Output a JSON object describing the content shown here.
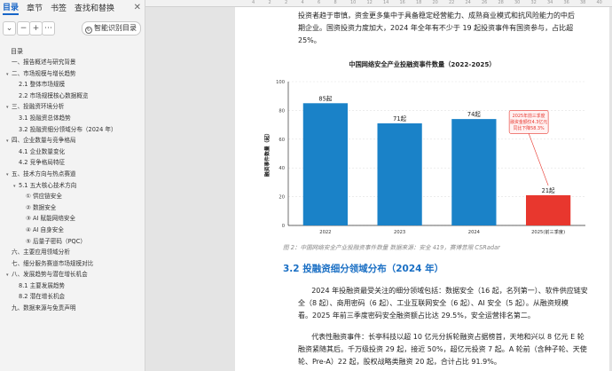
{
  "sidebar": {
    "tabs": [
      "目录",
      "章节",
      "书签",
      "查找和替换"
    ],
    "active_tab": "目录",
    "close_icon": "close-icon",
    "toolbar": {
      "collapse_icon": "chevron-down-icon",
      "add_icon": "plus-icon",
      "remove_icon": "minus-icon",
      "smart_label": "智能识别目录"
    },
    "toc_title": "目录",
    "toc": [
      {
        "text": "一、报告概述与研究背景",
        "level": 1
      },
      {
        "text": "二、市场规模与增长趋势",
        "level": 1,
        "caret": "▾"
      },
      {
        "text": "2.1 整体市场规模",
        "level": 2
      },
      {
        "text": "2.2 市场规模核心数据概览",
        "level": 2
      },
      {
        "text": "三、投融资环境分析",
        "level": 1,
        "caret": "▾"
      },
      {
        "text": "3.1 投融资总体趋势",
        "level": 2
      },
      {
        "text": "3.2 投融资细分领域分布（2024 年）",
        "level": 2
      },
      {
        "text": "四、企业数量与竞争格局",
        "level": 1,
        "caret": "▾"
      },
      {
        "text": "4.1 企业数量变化",
        "level": 2
      },
      {
        "text": "4.2 竞争格局特征",
        "level": 2
      },
      {
        "text": "五、技术方向与热点赛道",
        "level": 1,
        "caret": "▾"
      },
      {
        "text": "5.1 五大核心技术方向",
        "level": 2,
        "caret": "▾"
      },
      {
        "text": "① 供应链安全",
        "level": 3
      },
      {
        "text": "② 数据安全",
        "level": 3
      },
      {
        "text": "③ AI 赋能网络安全",
        "level": 3
      },
      {
        "text": "④ AI 自身安全",
        "level": 3
      },
      {
        "text": "⑤ 后量子密码（PQC）",
        "level": 3
      },
      {
        "text": "六、主要应用领域分析",
        "level": 1
      },
      {
        "text": "七、细分服务赛道市场规模对比",
        "level": 1
      },
      {
        "text": "八、发展趋势与潜在增长机会",
        "level": 1,
        "caret": "▾"
      },
      {
        "text": "8.1 主要发展趋势",
        "level": 2
      },
      {
        "text": "8.2 潜在增长机会",
        "level": 2
      },
      {
        "text": "九、数据来源与免责声明",
        "level": 1
      }
    ]
  },
  "ruler": [
    "4",
    "2",
    "2",
    "4",
    "6",
    "8",
    "10",
    "12",
    "14",
    "16",
    "18",
    "20",
    "22",
    "24",
    "26",
    "28",
    "30",
    "32",
    "34",
    "36",
    "38",
    "40",
    "42"
  ],
  "document": {
    "para1": [
      "投资者趋于审慎，资金更多集中于具备稳定经营能力、成熟商业模式和抗风险能力的中后",
      "期企业。国资投资力度加大，2024 年全年有不少于 19 起投资事件有国资参与，占比超",
      "25%。"
    ],
    "caption": "图 2：中国网络安全产业投融资事件数量 数据来源：安全 419，赛博昔限 CSRadar",
    "section_heading": "3.2 投融资细分领域分布（2024 年）",
    "para2": [
      "2024 年投融资最受关注的细分领域包括：数据安全（16 起，名列第一）、软件供应链安",
      "全（8 起）、商用密码（6 起）、工业互联网安全（6 起）、AI 安全（5 起）。从融资规模",
      "看。2025 年前三季度密码安全融资额占比达 29.5%，安全运营排名第二。"
    ],
    "para3": [
      "代表性融资事件：长亭科技以超 10 亿元分拆轮融资占据榜首，天地和兴以 8 亿元 E 轮",
      "融资紧随其后。千万级投资 29 起，接近 50%，超亿元投资 7 起。A 轮前（含种子轮、天使",
      "轮、Pre-A）22 起，股权战略类融资 20 起，合计占比 91.9%。"
    ]
  },
  "chart_data": {
    "type": "bar",
    "title": "中国网络安全产业投融资事件数量（2022-2025）",
    "ylabel": "融资事件数量（起）",
    "xlabel": "",
    "categories": [
      "2022",
      "2023",
      "2024",
      "2025(前三季度)"
    ],
    "values": [
      85,
      71,
      74,
      21
    ],
    "data_labels": [
      "85起",
      "71起",
      "74起",
      "21起"
    ],
    "colors": [
      "#1a82c8",
      "#1a82c8",
      "#1a82c8",
      "#e8372e"
    ],
    "ylim": [
      0,
      100
    ],
    "yticks": [
      0,
      20,
      40,
      60,
      80,
      100
    ],
    "grid": true,
    "annotation": [
      "2025年前三季度",
      "融资金额仅4.3亿元",
      "同比下降58.3%"
    ],
    "annotation_color": "#e8372e"
  }
}
